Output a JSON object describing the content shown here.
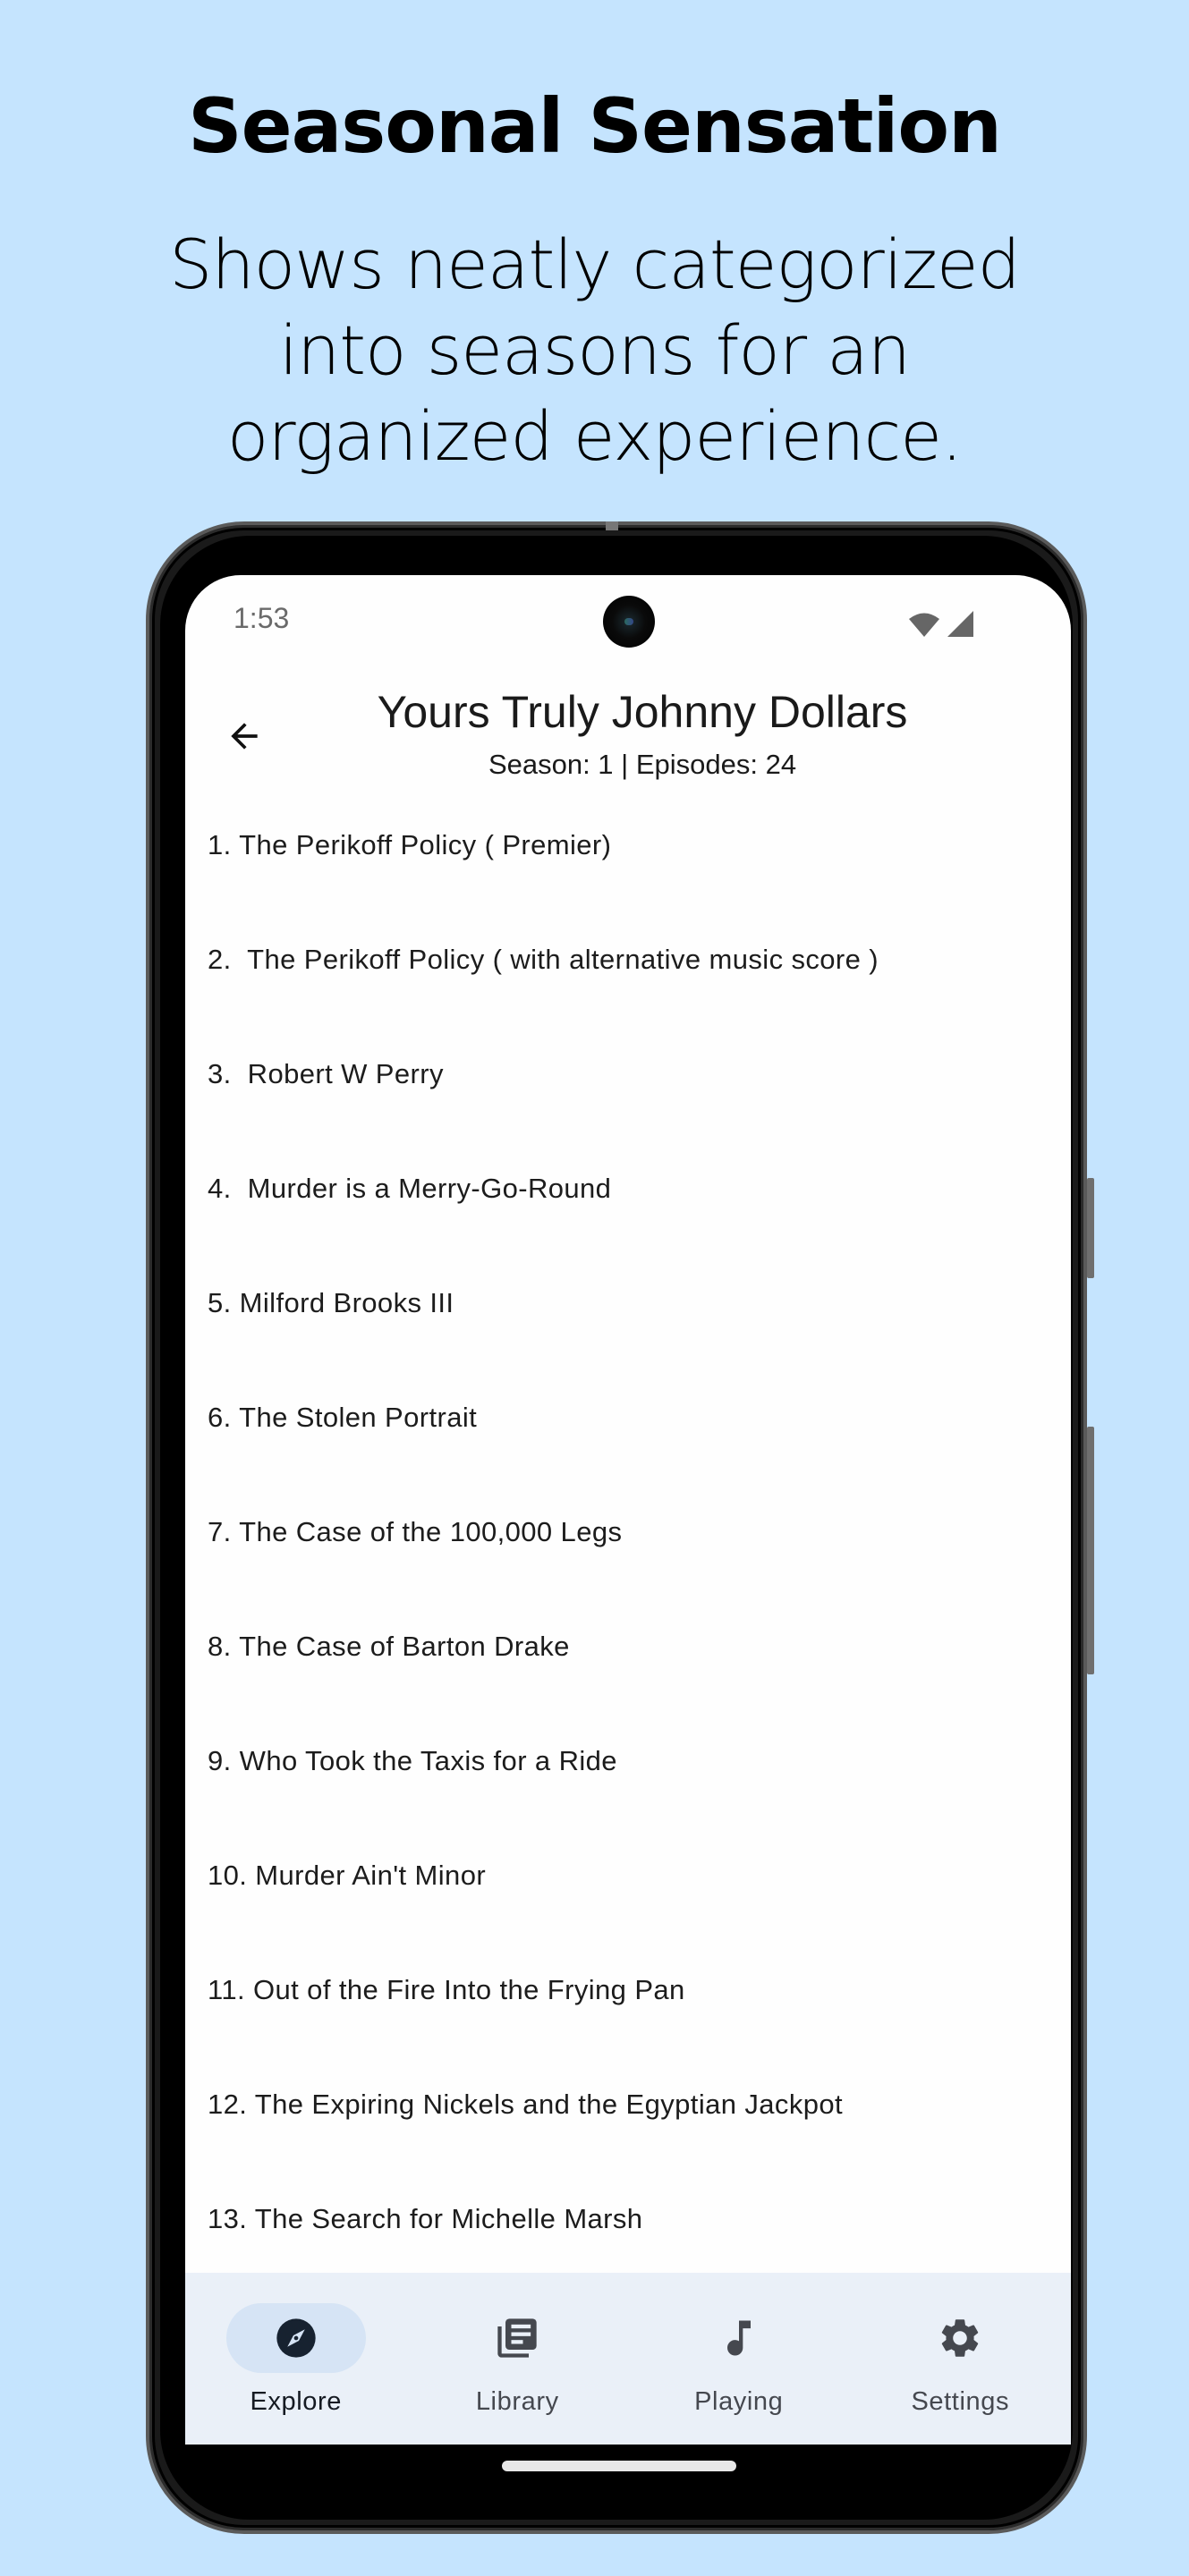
{
  "promo": {
    "title": "Seasonal Sensation",
    "subtitle_lines": [
      "Shows neatly categorized",
      "into seasons for an",
      "organized experience."
    ]
  },
  "status_bar": {
    "time": "1:53",
    "icons": [
      "wifi-icon",
      "cellular-signal-icon"
    ]
  },
  "app_bar": {
    "back_icon": "arrow-back-icon",
    "title": "Yours Truly Johnny Dollars",
    "subtitle": "Season: 1 | Episodes: 24"
  },
  "episodes": [
    "1. The Perikoff Policy ( Premier)",
    "2.  The Perikoff Policy ( with alternative music score )",
    "3.  Robert W Perry",
    "4.  Murder is a Merry-Go-Round",
    "5. Milford Brooks III",
    "6. The Stolen Portrait",
    "7. The Case of the 100,000 Legs",
    "8. The Case of Barton Drake",
    "9. Who Took the Taxis for a Ride",
    "10. Murder Ain't Minor",
    "11. Out of the Fire Into the Frying Pan",
    "12. The Expiring Nickels and the Egyptian Jackpot",
    "13. The Search for Michelle Marsh"
  ],
  "bottom_nav": {
    "items": [
      {
        "label": "Explore",
        "icon": "compass-icon",
        "active": true
      },
      {
        "label": "Library",
        "icon": "library-icon",
        "active": false
      },
      {
        "label": "Playing",
        "icon": "music-note-icon",
        "active": false
      },
      {
        "label": "Settings",
        "icon": "gear-icon",
        "active": false
      }
    ]
  },
  "colors": {
    "background": "#C5E4FE",
    "nav_background": "#EAF0F8",
    "nav_active_pill": "#D6E4F5",
    "icon_active": "#172230",
    "icon_inactive": "#45484f"
  }
}
